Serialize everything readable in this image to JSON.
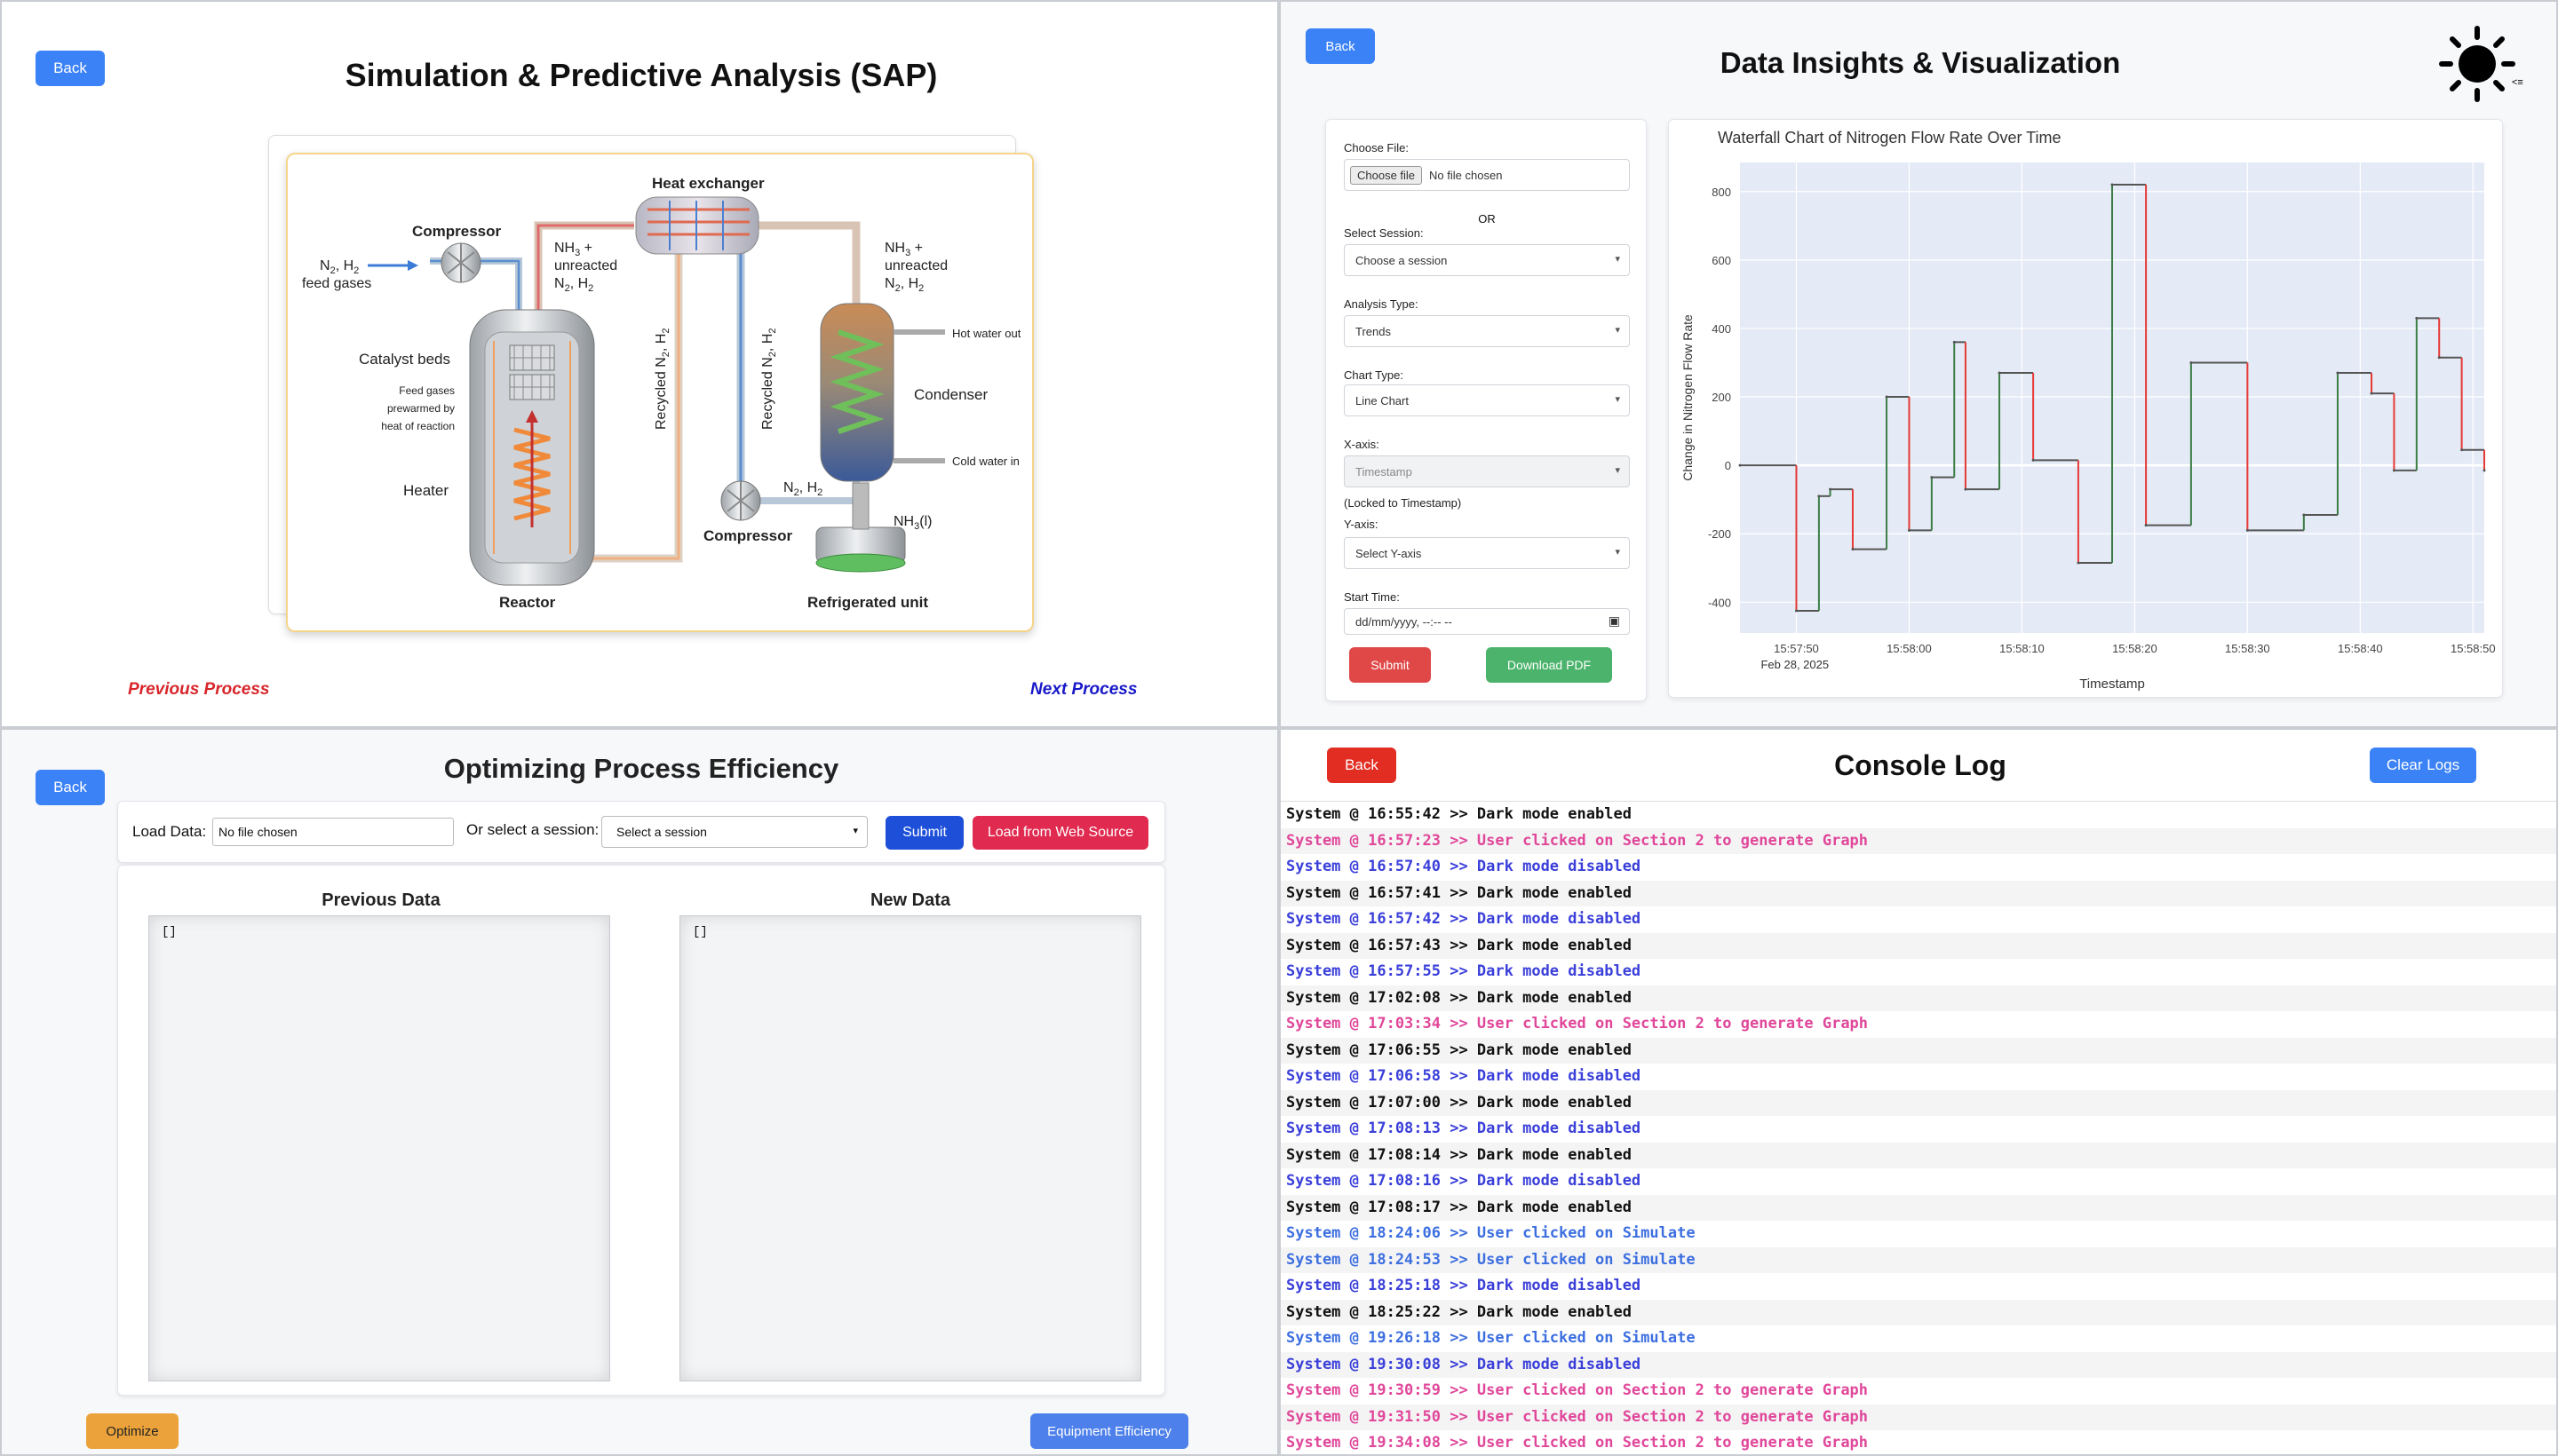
{
  "sap": {
    "back_label": "Back",
    "title": "Simulation & Predictive Analysis (SAP)",
    "prev_label": "Previous Process",
    "next_label": "Next Process",
    "diagram": {
      "heat_exchanger": "Heat exchanger",
      "compressor_top": "Compressor",
      "feed_1": "N",
      "feed_sub1": "2",
      "feed_2": ", H",
      "feed_sub2": "2",
      "feed_gases": "feed gases",
      "nh3_plus": "NH",
      "nh3_sub": "3",
      "plus": " +",
      "unreacted": "unreacted",
      "n2h2_a": "N",
      "n2h2_sub1": "2",
      "n2h2_b": ", H",
      "n2h2_sub2": "2",
      "catalyst_beds": "Catalyst beds",
      "feed_note_1": "Feed gases",
      "feed_note_2": "prewarmed by",
      "feed_note_3": "heat of reaction",
      "heater": "Heater",
      "reactor": "Reactor",
      "recycled_1": "Recycled N",
      "recycled_sub": "2",
      "recycled_2": ", H",
      "recycled_sub2": "2",
      "hot_water_out": "Hot water out",
      "condenser": "Condenser",
      "cold_water_in": "Cold water in",
      "compressor_bottom": "Compressor",
      "n2h2_low_a": "N",
      "n2h2_low_sub1": "2",
      "n2h2_low_b": ", H",
      "n2h2_low_sub2": "2",
      "nh3l": "NH",
      "nh3l_sub": "3",
      "nh3l_tail": "(l)",
      "refrigerated_unit": "Refrigerated unit"
    }
  },
  "insights": {
    "back_label": "Back",
    "title": "Data Insights & Visualization",
    "theme_icon": "sun-icon",
    "choose_file_label": "Choose File:",
    "choose_file_button": "Choose file",
    "no_file": "No file chosen",
    "or": "OR",
    "select_session_label": "Select Session:",
    "select_session_value": "Choose a session",
    "analysis_type_label": "Analysis Type:",
    "analysis_type_value": "Trends",
    "chart_type_label": "Chart Type:",
    "chart_type_value": "Line Chart",
    "x_axis_label": "X-axis:",
    "x_axis_value": "Timestamp",
    "locked_note": "(Locked to Timestamp)",
    "y_axis_label": "Y-axis:",
    "y_axis_value": "Select Y-axis",
    "start_time_label": "Start Time:",
    "start_time_placeholder": "dd/mm/yyyy, --:-- --",
    "submit_label": "Submit",
    "pdf_label": "Download PDF",
    "colors": {
      "up": "#3a7d44",
      "down": "#e53935",
      "plot_bg": "#e5ebf6"
    }
  },
  "chart_data": {
    "type": "line",
    "title": "Waterfall Chart of Nitrogen Flow Rate Over Time",
    "xlabel": "Timestamp",
    "ylabel": "Change in Nitrogen Flow Rate",
    "x_date_label": "Feb 28, 2025",
    "x_ticks": [
      "15:57:50",
      "15:58:00",
      "15:58:10",
      "15:58:20",
      "15:58:30",
      "15:58:40",
      "15:58:50"
    ],
    "y_ticks": [
      800,
      600,
      400,
      200,
      0,
      -200,
      -400
    ],
    "xlim": [
      "15:57:45",
      "15:58:51"
    ],
    "ylim": [
      -490,
      885
    ],
    "x": [
      "15:57:45",
      "15:57:50",
      "15:57:52",
      "15:57:53",
      "15:57:55",
      "15:57:58",
      "15:58:00",
      "15:58:02",
      "15:58:04",
      "15:58:05",
      "15:58:08",
      "15:58:11",
      "15:58:15",
      "15:58:18",
      "15:58:21",
      "15:58:25",
      "15:58:30",
      "15:58:35",
      "15:58:38",
      "15:58:41",
      "15:58:43",
      "15:58:45",
      "15:58:47",
      "15:58:49",
      "15:58:51"
    ],
    "y": [
      0,
      -425,
      -90,
      -70,
      -245,
      200,
      -190,
      -35,
      360,
      -70,
      270,
      15,
      -285,
      820,
      -175,
      300,
      -190,
      -145,
      270,
      210,
      -15,
      430,
      315,
      45,
      -15
    ],
    "series": [
      {
        "name": "",
        "values_ref": "y"
      }
    ]
  },
  "poe": {
    "back_label": "Back",
    "title": "Optimizing Process Efficiency",
    "load_label": "Load Data:",
    "no_file": "No file chosen",
    "session_label": "Or select a session:",
    "session_value": "Select a session",
    "submit_label": "Submit",
    "web_label": "Load from Web Source",
    "prev_title": "Previous Data",
    "new_title": "New Data",
    "prev_content": "[]",
    "new_content": "[]",
    "optimize_label": "Optimize",
    "equipment_label": "Equipment Efficiency"
  },
  "console": {
    "back_label": "Back",
    "title": "Console Log",
    "clear_label": "Clear Logs",
    "colors": {
      "enabled": "#111111",
      "disabled": "#3a3fd9",
      "graph": "#e0479a",
      "simulate": "#3d6fe0"
    },
    "logs": [
      {
        "text": "System @ 16:55:42 >> Dark mode enabled",
        "kind": "enabled"
      },
      {
        "text": "System @ 16:57:23 >> User clicked on Section 2 to generate Graph",
        "kind": "graph"
      },
      {
        "text": "System @ 16:57:40 >> Dark mode disabled",
        "kind": "disabled"
      },
      {
        "text": "System @ 16:57:41 >> Dark mode enabled",
        "kind": "enabled"
      },
      {
        "text": "System @ 16:57:42 >> Dark mode disabled",
        "kind": "disabled"
      },
      {
        "text": "System @ 16:57:43 >> Dark mode enabled",
        "kind": "enabled"
      },
      {
        "text": "System @ 16:57:55 >> Dark mode disabled",
        "kind": "disabled"
      },
      {
        "text": "System @ 17:02:08 >> Dark mode enabled",
        "kind": "enabled"
      },
      {
        "text": "System @ 17:03:34 >> User clicked on Section 2 to generate Graph",
        "kind": "graph"
      },
      {
        "text": "System @ 17:06:55 >> Dark mode enabled",
        "kind": "enabled"
      },
      {
        "text": "System @ 17:06:58 >> Dark mode disabled",
        "kind": "disabled"
      },
      {
        "text": "System @ 17:07:00 >> Dark mode enabled",
        "kind": "enabled"
      },
      {
        "text": "System @ 17:08:13 >> Dark mode disabled",
        "kind": "disabled"
      },
      {
        "text": "System @ 17:08:14 >> Dark mode enabled",
        "kind": "enabled"
      },
      {
        "text": "System @ 17:08:16 >> Dark mode disabled",
        "kind": "disabled"
      },
      {
        "text": "System @ 17:08:17 >> Dark mode enabled",
        "kind": "enabled"
      },
      {
        "text": "System @ 18:24:06 >> User clicked on Simulate",
        "kind": "simulate"
      },
      {
        "text": "System @ 18:24:53 >> User clicked on Simulate",
        "kind": "simulate"
      },
      {
        "text": "System @ 18:25:18 >> Dark mode disabled",
        "kind": "disabled"
      },
      {
        "text": "System @ 18:25:22 >> Dark mode enabled",
        "kind": "enabled"
      },
      {
        "text": "System @ 19:26:18 >> User clicked on Simulate",
        "kind": "simulate"
      },
      {
        "text": "System @ 19:30:08 >> Dark mode disabled",
        "kind": "disabled"
      },
      {
        "text": "System @ 19:30:59 >> User clicked on Section 2 to generate Graph",
        "kind": "graph"
      },
      {
        "text": "System @ 19:31:50 >> User clicked on Section 2 to generate Graph",
        "kind": "graph"
      },
      {
        "text": "System @ 19:34:08 >> User clicked on Section 2 to generate Graph",
        "kind": "graph"
      }
    ]
  }
}
